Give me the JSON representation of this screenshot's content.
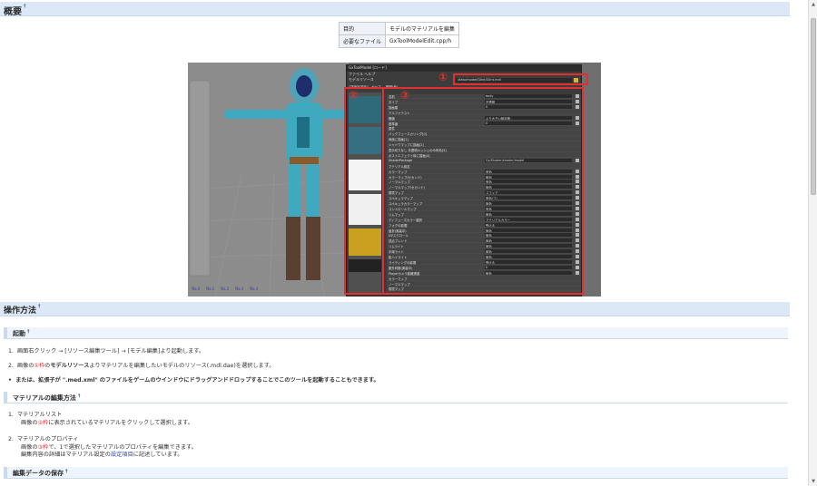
{
  "sections": {
    "overview_heading": "概要",
    "howto_heading": "操作方法"
  },
  "info_table": {
    "rows": [
      {
        "key": "目的",
        "value": "モデルのマテリアルを編集"
      },
      {
        "key": "必要なファイル",
        "value": "GxToolModelEdit.cpp/h"
      }
    ]
  },
  "screenshot": {
    "markers": [
      "①",
      "②",
      "③"
    ],
    "panel": {
      "title": "GxToolModel [ロード]",
      "menu": "ファイル  ヘルプ",
      "resource_label": "モデルリソース",
      "path": "/data/model/Glint/Glint.mdl",
      "tabs": [
        "マテリアル",
        "ポーズ",
        "情報(仮)"
      ],
      "props": [
        {
          "name": "名前",
          "value": "body"
        },
        {
          "name": "タイプ",
          "value": "不透明"
        },
        {
          "name": "描画順",
          "value": "0"
        },
        {
          "name": "アルファテスト",
          "value": ""
        },
        {
          "name": "閾値",
          "value": "より大きい時合格"
        },
        {
          "name": "基準値",
          "value": "0"
        },
        {
          "name": "属性",
          "value": ""
        },
        {
          "name": "バックフェースカリング[0]",
          "value": ""
        },
        {
          "name": "両面に描画[1]",
          "value": ""
        },
        {
          "name": "シャドウマップに描画[2]",
          "value": ""
        },
        {
          "name": "表示切りなし 半透明メッシュのみ有効[3]",
          "value": ""
        },
        {
          "name": "ポストエフェクト後に描画[4]",
          "value": ""
        },
        {
          "name": "ShaderPackage",
          "value": "Gx/Shader/shader/model"
        },
        {
          "name": "マテリアル設定",
          "value": ""
        },
        {
          "name": "カラーマップ",
          "value": "有効"
        },
        {
          "name": "カラーマップ(セカンド)",
          "value": "無効"
        },
        {
          "name": "ノーマルマップ",
          "value": "有効"
        },
        {
          "name": "ノーマルマップ(セカンド)",
          "value": "無効"
        },
        {
          "name": "環境マップ",
          "value": "スフィア"
        },
        {
          "name": "スペキュラマップ",
          "value": "有効(フ)"
        },
        {
          "name": "スペキュラカラーマップ",
          "value": "無効"
        },
        {
          "name": "コントロールマップ",
          "value": "有効"
        },
        {
          "name": "リムマップ",
          "value": "無効"
        },
        {
          "name": "ディフューズカラー選択",
          "value": "マテリアルカラー"
        },
        {
          "name": "フォグの影響",
          "value": "受ける"
        },
        {
          "name": "屈折(実装中)",
          "value": "無効"
        },
        {
          "name": "UVスクロール",
          "value": "無効"
        },
        {
          "name": "頂点ブレンド",
          "value": "無効"
        },
        {
          "name": "リムライト",
          "value": "無効"
        },
        {
          "name": "半球ライト",
          "value": "無効"
        },
        {
          "name": "影ハイライト",
          "value": "無効"
        },
        {
          "name": "ライティングの影響",
          "value": "受ける"
        },
        {
          "name": "屋外判断(実装中)",
          "value": "0"
        },
        {
          "name": "Playerカメラ距離透過",
          "value": "無効"
        },
        {
          "name": "カラーマップ",
          "value": ""
        },
        {
          "name": "ノーマルマップ",
          "value": ""
        },
        {
          "name": "環境マップ",
          "value": ""
        }
      ],
      "viewport_labels": [
        "No.0",
        "No.1",
        "No.2",
        "No.3",
        "No.4"
      ]
    }
  },
  "howto": {
    "startup_heading": "起動",
    "step1_prefix": "1.",
    "step1": "画面右クリック → [リソース編集ツール] → [モデル編集]より起動します。",
    "step2_prefix": "2.",
    "step2_a": "画像の",
    "step2_mark": "①枠",
    "step2_b": "の",
    "step2_bold": "モデルリソース",
    "step2_c": "よりマテリアルを編集したいモデルのリソース(.mdl.dae)を選択します。",
    "bullet": "または、拡張子が \".med.xml\" のファイルをゲームのウインドウにドラッグアンドドロップすることでこのツールを起動することもできます。",
    "material_heading": "マテリアルの編集方法",
    "m1_prefix": "1.",
    "m1_title": "マテリアルリスト",
    "m1_a": "画像の",
    "m1_mark": "②枠",
    "m1_b": "に表示されているマテリアルをクリックして選択します。",
    "m2_prefix": "2.",
    "m2_title": "マテリアルのプロパティ",
    "m2_a": "画像の",
    "m2_mark": "③枠",
    "m2_b": "で、1で選択したマテリアルのプロパティを編集できます。",
    "m2_line2_a": "編集内容の詳細はマテリアル設定の",
    "m2_link": "設定項目",
    "m2_line2_b": "に記述しています。",
    "save_heading": "編集データの保存"
  },
  "colors": {
    "accent_red": "#e03030",
    "heading_bg": "#dde8f6",
    "link_blue": "#2a4fb0"
  }
}
